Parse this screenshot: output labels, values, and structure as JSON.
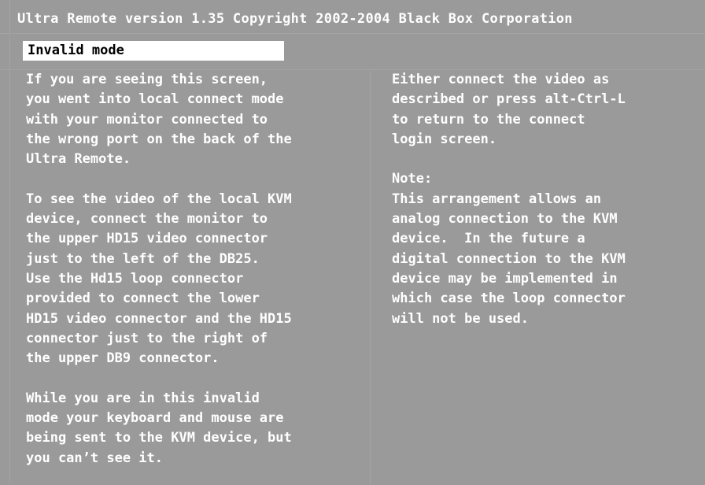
{
  "app": {
    "title": "Ultra Remote version 1.35 Copyright 2002-2004 Black Box Corporation"
  },
  "mode_label": "Invalid mode",
  "left_column": {
    "paragraphs": [
      [
        "If you are seeing this screen,",
        "you went into local connect mode",
        "with your monitor connected to",
        "the wrong port on the back of the",
        "Ultra Remote."
      ],
      [
        "To see the video of the local KVM",
        "device, connect the monitor to",
        "the upper HD15 video connector",
        "just to the left of the DB25.",
        "Use the Hd15 loop connector",
        "provided to connect the lower",
        "HD15 video connector and the HD15",
        "connector just to the right of",
        "the upper DB9 connector."
      ],
      [
        "While you are in this invalid",
        "mode your keyboard and mouse are",
        "being sent to the KVM device, but",
        "you can’t see it."
      ]
    ]
  },
  "right_column": {
    "paragraphs": [
      [
        "Either connect the video as",
        "described or press alt-Ctrl-L",
        "to return to the connect",
        "login screen."
      ],
      [
        "Note:",
        "This arrangement allows an",
        "analog connection to the KVM",
        "device.  In the future a",
        "digital connection to the KVM",
        "device may be implemented in",
        "which case the loop connector",
        "will not be used."
      ]
    ]
  },
  "colors": {
    "background": "#9a9a9a",
    "text": "#ffffff",
    "mode_box_bg": "#ffffff",
    "mode_box_text": "#000000"
  }
}
